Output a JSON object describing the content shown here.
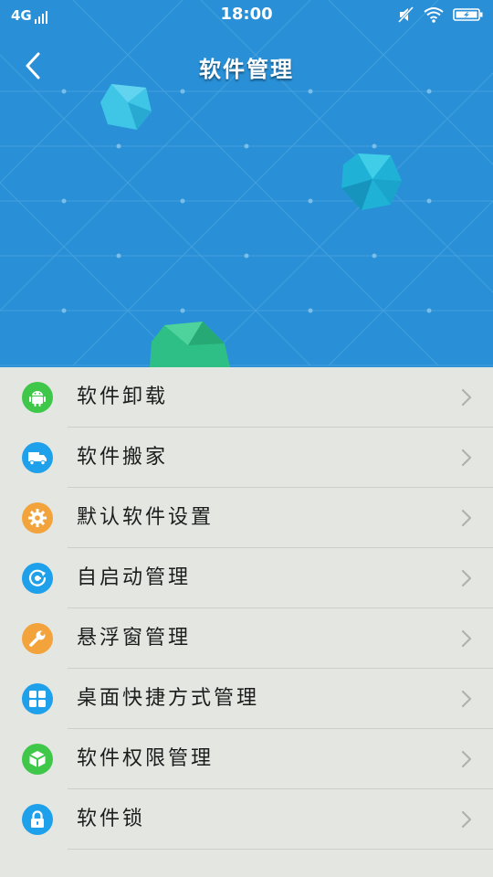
{
  "status_bar": {
    "network": "4G",
    "time": "18:00"
  },
  "header": {
    "title": "软件管理",
    "bg_color": "#2990d7"
  },
  "menu": [
    {
      "label": "软件卸载",
      "icon": "android-icon",
      "color": "#3fc74a"
    },
    {
      "label": "软件搬家",
      "icon": "truck-icon",
      "color": "#1ea1ea"
    },
    {
      "label": "默认软件设置",
      "icon": "gear-icon",
      "color": "#f3a33b"
    },
    {
      "label": "自启动管理",
      "icon": "clock-icon",
      "color": "#1ea1ea"
    },
    {
      "label": "悬浮窗管理",
      "icon": "wrench-icon",
      "color": "#f3a33b"
    },
    {
      "label": "桌面快捷方式管理",
      "icon": "grid-icon",
      "color": "#1ea1ea"
    },
    {
      "label": "软件权限管理",
      "icon": "cube-icon",
      "color": "#3fc74a"
    },
    {
      "label": "软件锁",
      "icon": "lock-icon",
      "color": "#1ea1ea"
    }
  ]
}
